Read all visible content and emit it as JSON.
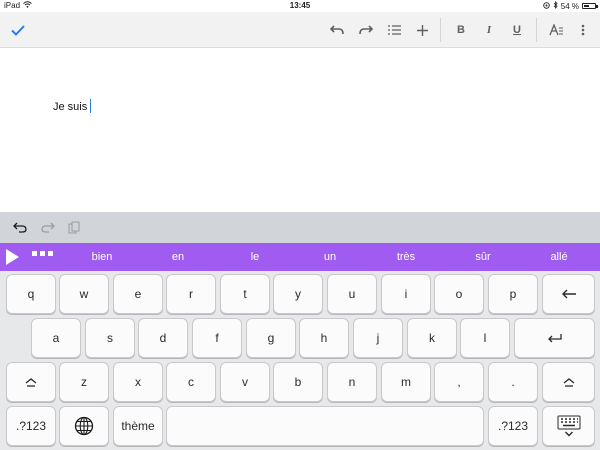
{
  "status_bar": {
    "device": "iPad",
    "time": "13:45",
    "battery": "54 %",
    "battery_level": 0.54
  },
  "toolbar": {
    "icons": [
      "check-icon",
      "undo-icon",
      "redo-icon",
      "list-icon",
      "plus-icon",
      "bold-icon",
      "italic-icon",
      "underline-icon",
      "text-format-icon",
      "more-icon"
    ],
    "bold_label": "B",
    "italic_label": "I",
    "underline_label": "U"
  },
  "document": {
    "text": "Je suis"
  },
  "shortcut_bar": {
    "icons": [
      "undo-icon",
      "redo-icon",
      "paste-icon"
    ]
  },
  "suggestions": {
    "words": [
      "bien",
      "en",
      "le",
      "un",
      "très",
      "sûr",
      "allé"
    ],
    "accent": "#a05bf1"
  },
  "keyboard": {
    "row1": [
      "q",
      "w",
      "e",
      "r",
      "t",
      "y",
      "u",
      "i",
      "o",
      "p"
    ],
    "row2": [
      "a",
      "s",
      "d",
      "f",
      "g",
      "h",
      "j",
      "k",
      "l"
    ],
    "row3": [
      "z",
      "x",
      "c",
      "v",
      "b",
      "n",
      "m",
      ",",
      "."
    ],
    "numbers_key": ".?123",
    "theme_key": "thème"
  }
}
